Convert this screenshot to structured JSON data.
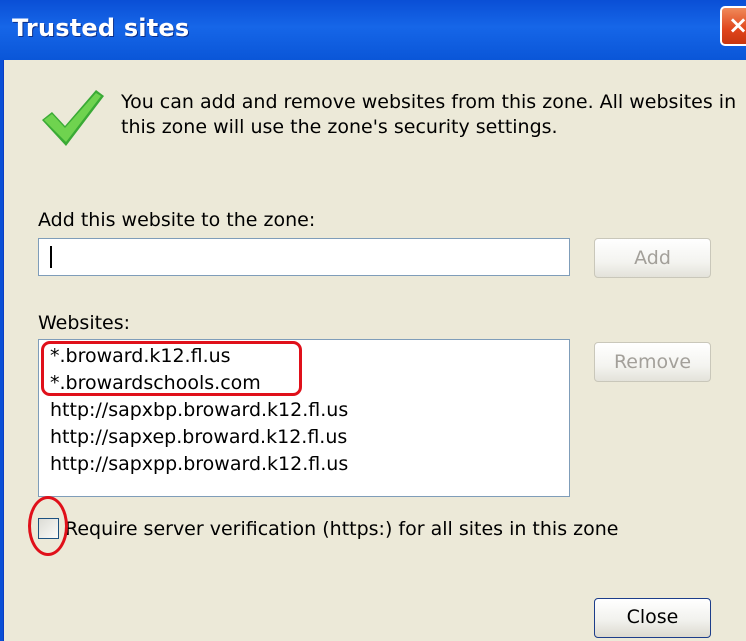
{
  "window": {
    "title": "Trusted sites",
    "close_glyph": "×"
  },
  "info": {
    "icon": "check-icon",
    "text": "You can add and remove websites from this zone. All websites in this zone will use the zone's security settings."
  },
  "add_section": {
    "label": "Add this website to the zone:",
    "input_value": "",
    "add_button": "Add"
  },
  "websites_section": {
    "label": "Websites:",
    "items": [
      "*.broward.k12.fl.us",
      "*.browardschools.com",
      "http://sapxbp.broward.k12.fl.us",
      "http://sapxep.broward.k12.fl.us",
      "http://sapxpp.broward.k12.fl.us"
    ],
    "remove_button": "Remove"
  },
  "verification": {
    "label": "Require server verification (https:) for all sites in this zone",
    "checked": false
  },
  "footer": {
    "close_button": "Close"
  },
  "colors": {
    "title_bar": "#0a4fd6",
    "dialog_bg": "#ece9d8",
    "annotation": "#e0101a",
    "check_green": "#3aaa35"
  }
}
